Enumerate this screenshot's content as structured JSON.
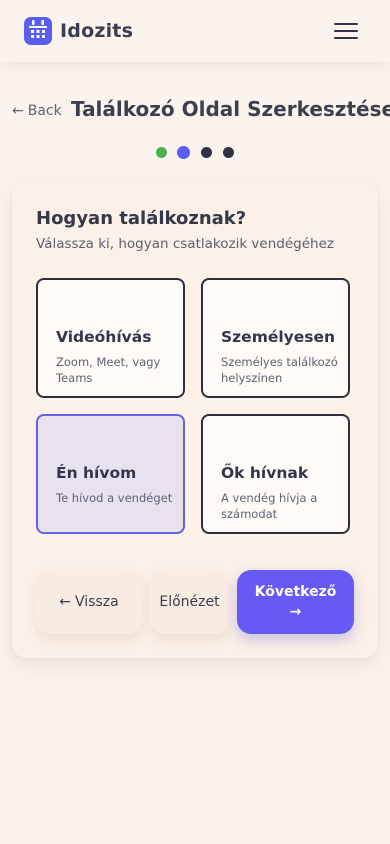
{
  "app": {
    "name": "Idozits",
    "brand_color": "#5b5cf0"
  },
  "nav": {
    "back_label": "Back",
    "page_title": "Találkozó Oldal Szerkesztése"
  },
  "steps": {
    "total": 4,
    "current": 2,
    "colors": [
      "#4caf50",
      "#5b5cf0",
      "#2f3345",
      "#2f3345"
    ]
  },
  "question": {
    "title": "Hogyan találkoznak?",
    "subtitle": "Válassza ki, hogyan csatlakozik vendégéhez"
  },
  "options": [
    {
      "title": "Videóhívás",
      "desc": "Zoom, Meet, vagy Teams",
      "selected": false
    },
    {
      "title": "Személyesen",
      "desc": "Személyes találkozó helyszínen",
      "selected": false
    },
    {
      "title": "Én hívom",
      "desc": "Te hívod a vendéget",
      "selected": true
    },
    {
      "title": "Ők hívnak",
      "desc": "A vendég hívja a számodat",
      "selected": false
    }
  ],
  "buttons": {
    "back": "Vissza",
    "preview": "Előnézet",
    "next": "Következő"
  },
  "icons": {
    "logo": "calendar-icon",
    "menu": "hamburger-menu-icon",
    "back": "arrow-left-icon",
    "next": "arrow-right-icon"
  }
}
